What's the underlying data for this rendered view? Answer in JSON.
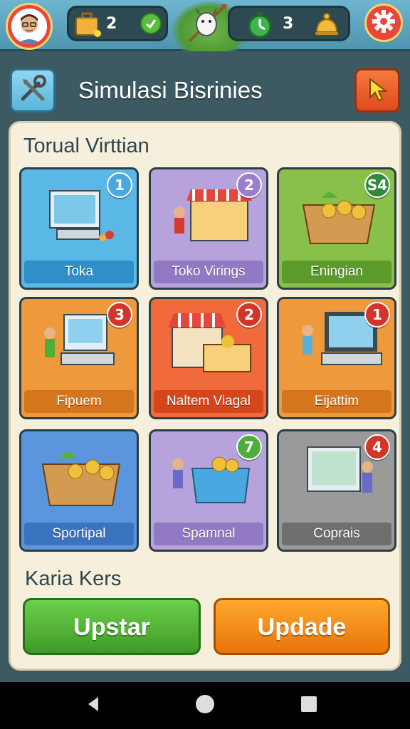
{
  "status": {
    "briefcase_count": "2",
    "timer_count": "3"
  },
  "header": {
    "title": "Simulasi Bisrinies"
  },
  "sections": {
    "main": "Torual Virttian",
    "secondary": "Karia Kers"
  },
  "cards": [
    {
      "label": "Toka",
      "badge": "1",
      "color": "#5ab8e6",
      "label_color": "#2e8fc9",
      "badge_color": "#4aa8e0"
    },
    {
      "label": "Toko Virings",
      "badge": "2",
      "color": "#b7a3dc",
      "label_color": "#9179c3",
      "badge_color": "#9a7fd0"
    },
    {
      "label": "Eningian",
      "badge": "S4",
      "color": "#88c04a",
      "label_color": "#5c9a2c",
      "badge_color": "#2f8a3a"
    },
    {
      "label": "Fipuem",
      "badge": "3",
      "color": "#ee9a3c",
      "label_color": "#d5761f",
      "badge_color": "#d2352a"
    },
    {
      "label": "Naltem Viagal",
      "badge": "2",
      "color": "#f06a3c",
      "label_color": "#d5461c",
      "badge_color": "#d2352a"
    },
    {
      "label": "Eijattim",
      "badge": "1",
      "color": "#ee9a3c",
      "label_color": "#d5761f",
      "badge_color": "#d2352a"
    },
    {
      "label": "Sportipal",
      "badge": "",
      "color": "#5b95de",
      "label_color": "#3a74c0",
      "badge_color": ""
    },
    {
      "label": "Spamnal",
      "badge": "7",
      "color": "#b7a3dc",
      "label_color": "#9179c3",
      "badge_color": "#4fae3a"
    },
    {
      "label": "Coprais",
      "badge": "4",
      "color": "#9a9a9a",
      "label_color": "#6f6f6f",
      "badge_color": "#d2352a"
    }
  ],
  "buttons": {
    "left": "Upstar",
    "right": "Updade"
  },
  "colors": {
    "left_button": "#4caf38",
    "right_button": "#f28a14"
  },
  "icons": {
    "avatar": "user-avatar",
    "briefcase": "briefcase-icon",
    "check": "check-icon",
    "goat": "goat-mascot",
    "timer": "timer-icon",
    "bell": "bell-icon",
    "gear": "gear-icon",
    "tools": "tools-icon",
    "cursor": "cursor-icon"
  }
}
